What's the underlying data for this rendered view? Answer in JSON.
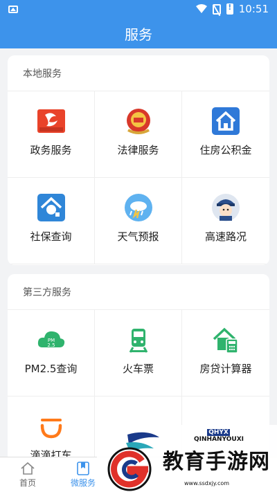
{
  "statusbar": {
    "time": "10:51"
  },
  "title": "服务",
  "sections": [
    {
      "title": "本地服务",
      "items": [
        {
          "label": "政务服务"
        },
        {
          "label": "法律服务"
        },
        {
          "label": "住房公积金"
        },
        {
          "label": "社保查询"
        },
        {
          "label": "天气预报"
        },
        {
          "label": "高速路况"
        }
      ]
    },
    {
      "title": "第三方服务",
      "items": [
        {
          "label": "PM2.5查询"
        },
        {
          "label": "火车票"
        },
        {
          "label": "房贷计算器"
        },
        {
          "label": "滴滴打车"
        }
      ]
    }
  ],
  "tabs": [
    {
      "label": "首页"
    },
    {
      "label": "微服务"
    }
  ],
  "watermark": {
    "text": "教育手游网",
    "url": "www.ssdxjy.com",
    "brand": "QINHANYOUXI",
    "brand_boxes": "QHYX"
  },
  "colors": {
    "primary": "#3d93eb",
    "green": "#2fb36d",
    "orange": "#ff7a1a"
  }
}
